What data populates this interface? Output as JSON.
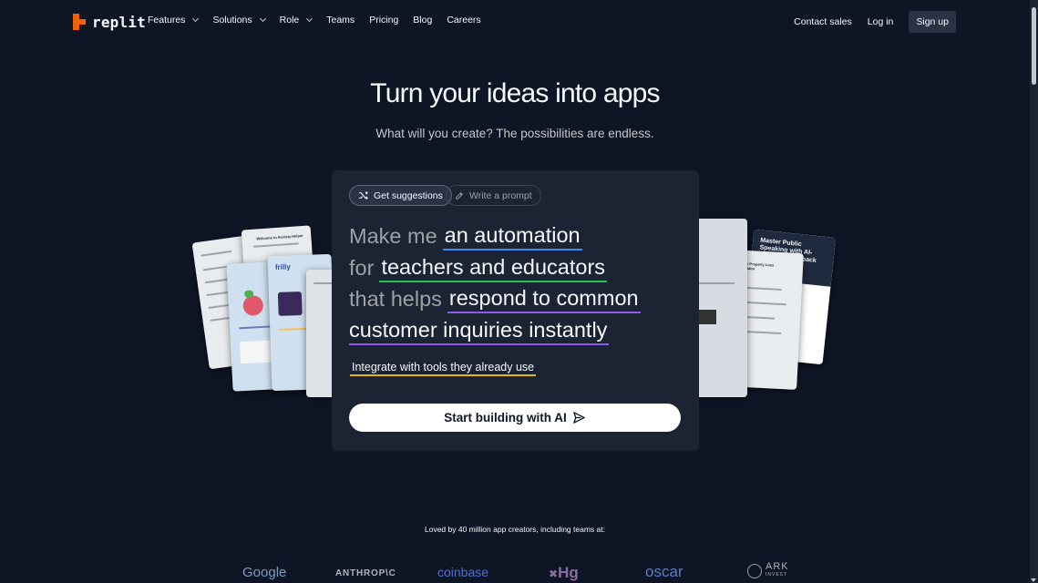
{
  "nav": {
    "logo_text": "replit",
    "items": [
      {
        "label": "Features",
        "dropdown": true
      },
      {
        "label": "Solutions",
        "dropdown": true
      },
      {
        "label": "Role",
        "dropdown": true
      },
      {
        "label": "Teams",
        "dropdown": false
      },
      {
        "label": "Pricing",
        "dropdown": false
      },
      {
        "label": "Blog",
        "dropdown": false
      },
      {
        "label": "Careers",
        "dropdown": false
      }
    ],
    "contact": "Contact sales",
    "login": "Log in",
    "signup": "Sign up"
  },
  "hero": {
    "title": "Turn your ideas into apps",
    "subtitle": "What will you create? The possibilities are endless."
  },
  "panel": {
    "chip_suggestions": "Get suggestions",
    "chip_prompt": "Write a prompt",
    "sentence": {
      "w1": "Make me",
      "p1": "an automation",
      "w2": "for",
      "p2": "teachers and educators",
      "w3": "that helps",
      "p3": "respond to common",
      "p4": "customer inquiries instantly"
    },
    "integrate": "Integrate with tools they already use",
    "start_button": "Start building with AI"
  },
  "cards": {
    "right_top": "Master Public Speaking with AI-Powered Feedback",
    "right_mid": "Single Property Loss Calculator",
    "left_welcome": "Welcome to Anxiety Helper",
    "left_brand": "frilly"
  },
  "social_proof": {
    "text": "Loved by 40 million app creators, including teams at:",
    "logos": [
      "Google",
      "ANTHROP\\C",
      "coinbase",
      "Hg",
      "oscar",
      "ARK",
      "INVEST"
    ]
  },
  "colors": {
    "background": "#0e1525",
    "panel": "#1c2333",
    "accent_orange": "#f26207",
    "underline_blue": "#3b8af0",
    "underline_green": "#29bc51",
    "underline_purple": "#8c5cf0",
    "underline_yellow": "#e8b700"
  }
}
